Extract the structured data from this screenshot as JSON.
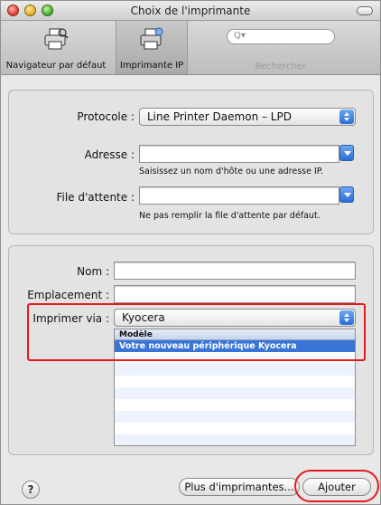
{
  "window": {
    "title": "Choix de l'imprimante"
  },
  "toolbar": {
    "default_browser_label": "Navigateur par défaut",
    "ip_printer_label": "Imprimante IP",
    "search_placeholder": "Q▾",
    "search_label": "Rechercher"
  },
  "connection": {
    "protocol_label": "Protocole :",
    "protocol_value": "Line Printer Daemon – LPD",
    "address_label": "Adresse :",
    "address_value": "",
    "address_hint": "Saisissez un nom d'hôte ou une adresse IP.",
    "queue_label": "File d'attente :",
    "queue_value": "",
    "queue_hint": "Ne pas remplir la file d'attente par défaut."
  },
  "printer_info": {
    "name_label": "Nom :",
    "name_value": "",
    "location_label": "Emplacement :",
    "location_value": "",
    "print_using_label": "Imprimer via :",
    "print_using_value": "Kyocera",
    "list_header": "Modèle",
    "models": [
      "Votre nouveau périphérique Kyocera"
    ]
  },
  "footer": {
    "help_symbol": "?",
    "more_printers_label": "Plus d'imprimantes...",
    "add_label": "Ajouter"
  },
  "colors": {
    "highlight": "#e8191c",
    "selection": "#3875d7",
    "accent_blue": "#2a6fd6"
  }
}
